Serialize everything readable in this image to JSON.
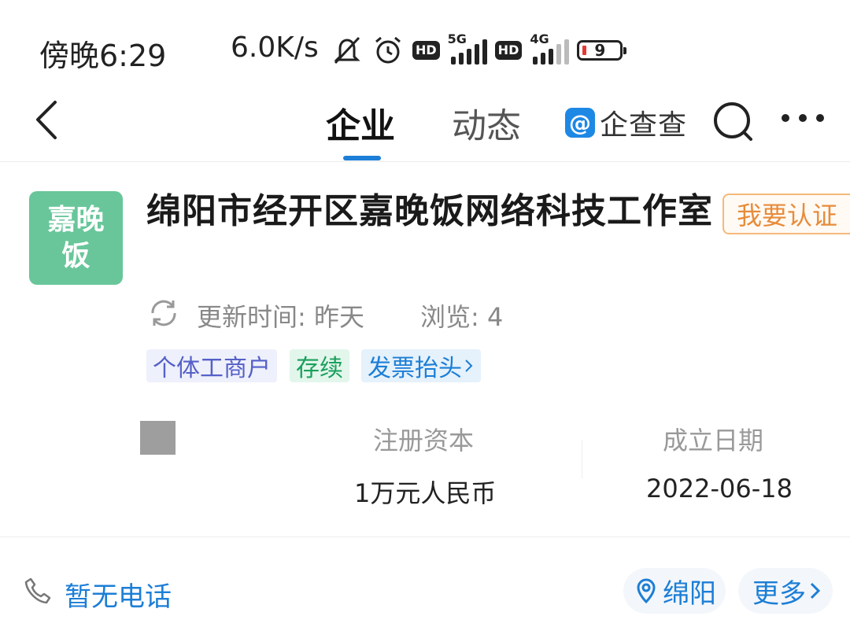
{
  "status_bar": {
    "time": "傍晚6:29",
    "speed": "6.0K/s",
    "hd": "HD",
    "net1": "5G",
    "net2": "4G",
    "battery": "9"
  },
  "nav": {
    "tabs": [
      "企业",
      "动态"
    ],
    "brand": "企查查",
    "active_tab": "企业"
  },
  "company": {
    "logo_text": "嘉晚饭",
    "name": "绵阳市经开区嘉晚饭网络科技工作室",
    "verify_button": "我要认证",
    "update_time": "更新时间: 昨天",
    "views": "浏览: 4",
    "tags": [
      "个体工商户",
      "存续",
      "发票抬头"
    ],
    "stats": [
      {
        "label": "注册资本",
        "value": "1万元人民币"
      },
      {
        "label": "成立日期",
        "value": "2022-06-18"
      }
    ]
  },
  "footer": {
    "phone": "暂无电话",
    "location": "绵阳",
    "more": "更多"
  },
  "colors": {
    "accent": "#1c7ed6",
    "logo_bg": "#68c69a",
    "verify": "#e78c3b"
  }
}
